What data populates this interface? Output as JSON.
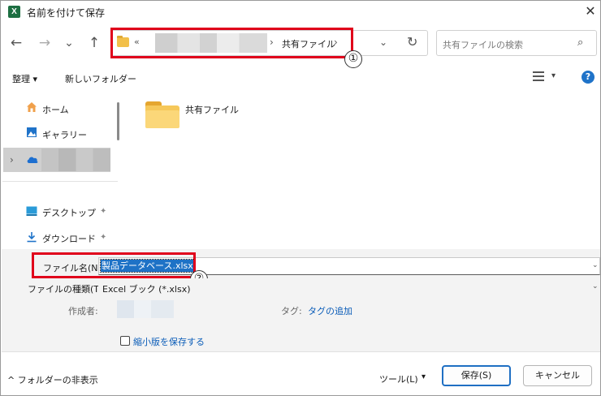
{
  "window": {
    "title": "名前を付けて保存",
    "app_icon": "X",
    "close_glyph": "✕"
  },
  "nav": {
    "back_glyph": "←",
    "forward_glyph": "→",
    "recent_glyph": "⌄",
    "up_glyph": "↑"
  },
  "address": {
    "overflow": "«",
    "separator": "›",
    "current_folder": "共有ファイル",
    "dropdown_glyph": "⌄",
    "refresh_glyph": "↻"
  },
  "search": {
    "placeholder": "共有ファイルの検索",
    "icon_glyph": "⌕"
  },
  "commandbar": {
    "organize": "整理 ▾",
    "new_folder": "新しいフォルダー",
    "view_dropdown": "▾",
    "help": "?"
  },
  "sidebar": {
    "items": [
      {
        "label": "ホーム",
        "icon": "home-icon"
      },
      {
        "label": "ギャラリー",
        "icon": "gallery-icon"
      },
      {
        "label": "",
        "icon": "onedrive-cloud-icon"
      },
      {
        "label": "デスクトップ",
        "icon": "desktop-icon",
        "pinned": true
      },
      {
        "label": "ダウンロード",
        "icon": "download-icon",
        "pinned": true
      }
    ],
    "expand_glyph": "›",
    "pin_glyph": "📌"
  },
  "content": {
    "items": [
      {
        "name": "共有ファイル",
        "type": "folder"
      }
    ]
  },
  "form": {
    "filename_label": "ファイル名(N):",
    "filename_value": "製品データベース.xlsx",
    "filetype_label": "ファイルの種類(T):",
    "filetype_value": "Excel ブック (*.xlsx)",
    "author_label": "作成者:",
    "tag_label": "タグ:",
    "tag_link": "タグの追加",
    "thumbnail_label": "縮小版を保存する",
    "dropdown_glyph": "⌄"
  },
  "annotations": {
    "badge1": "①",
    "badge2": "②"
  },
  "footer": {
    "hide_folders": "^ フォルダーの非表示",
    "tools": "ツール(L)",
    "tools_arrow": "▾",
    "save": "保存(S)",
    "cancel": "キャンセル"
  },
  "colors": {
    "accent": "#1f6fc3",
    "highlight_box": "#e0001b",
    "link": "#0a5cb8",
    "excel_green": "#1d6f42"
  }
}
